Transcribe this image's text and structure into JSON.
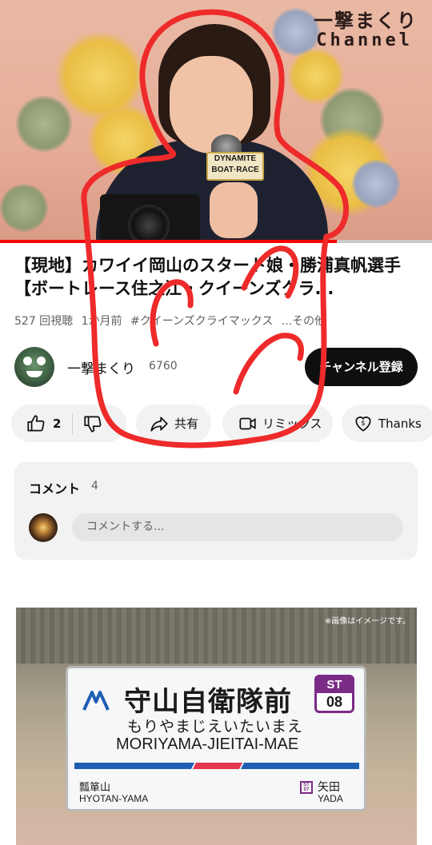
{
  "video": {
    "watermark_line1": "一撃まくり",
    "watermark_line2": "Channel",
    "mic_flag_line1": "DYNAMITE",
    "mic_flag_line2": "BOAT·RACE",
    "progress_fraction": 0.78,
    "progress_color": "#ff0000"
  },
  "title": "【現地】カワイイ岡山のスタート娘・勝浦真帆選手【ボートレース住之江・クイーンズクラ...",
  "meta": {
    "views": "527 回視聴",
    "age": "1か月前",
    "hashtag": "#クイーンズクライマックス",
    "more": "...その他"
  },
  "channel": {
    "name": "一撃まくり",
    "subscribers": "6760",
    "subscribe_label": "チャンネル登録"
  },
  "actions": {
    "like_count": "2",
    "share_label": "共有",
    "remix_label": "リミックス",
    "thanks_label": "Thanks",
    "icons": [
      "thumbs-up-icon",
      "thumbs-down-icon",
      "share-icon",
      "remix-icon",
      "thanks-icon"
    ]
  },
  "comments": {
    "label": "コメント",
    "count": "4",
    "placeholder": "コメントする..."
  },
  "ad": {
    "note": "※画像はイメージです。",
    "station_kanji": "守山自衛隊前",
    "station_kana": "もりやまじえいたいまえ",
    "station_roman": "MORIYAMA-JIEITAI-MAE",
    "line_code": "ST",
    "station_number": "08",
    "prev_station_jp": "瓢箪山",
    "prev_station_en": "HYOTAN-YAMA",
    "next_station_code": "ST 07",
    "next_station_jp": "矢田",
    "next_station_en": "YADA",
    "line_color": "#7a2b86"
  },
  "colors": {
    "scribble": "#ee2a2a",
    "subscribe_bg": "#0f0f0f"
  }
}
